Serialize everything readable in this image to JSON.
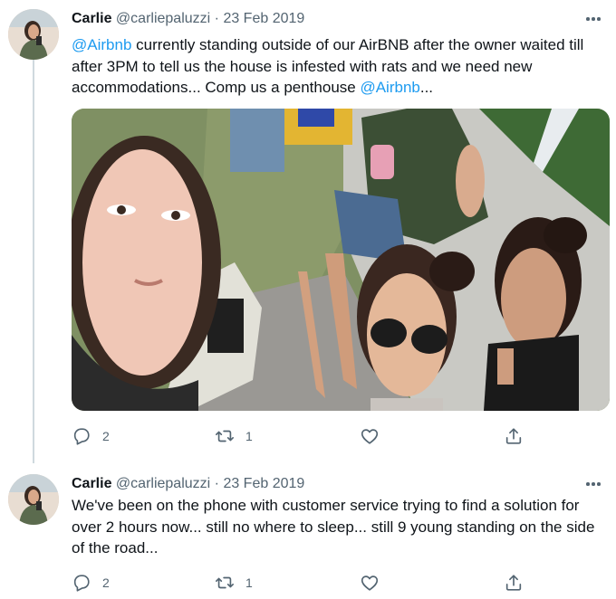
{
  "tweets": [
    {
      "author": {
        "name": "Carlie",
        "handle": "@carliepaluzzi"
      },
      "separator": "·",
      "date": "23 Feb 2019",
      "text": {
        "mention_start": "@Airbnb",
        "body": " currently standing outside of our AirBNB after the owner waited till after 3PM to tell us the house is infested with rats and we need new accommodations... Comp us a penthouse ",
        "mention_end": "@Airbnb",
        "ellipsis": "..."
      },
      "has_photo": true,
      "counts": {
        "replies": "2",
        "retweets": "1"
      }
    },
    {
      "author": {
        "name": "Carlie",
        "handle": "@carliepaluzzi"
      },
      "separator": "·",
      "date": "23 Feb 2019",
      "text": {
        "body": "We've been on the phone with customer service trying to find a solution for over 2 hours now... still no where to sleep... still 9 young standing on the side of the road..."
      },
      "has_photo": false,
      "counts": {
        "replies": "2",
        "retweets": "1"
      }
    }
  ],
  "colors": {
    "link": "#1d9bf0",
    "secondary": "#536471",
    "thread_line": "#cfd9de"
  },
  "icons": [
    "avatar-photo",
    "more-options-icon",
    "reply-icon",
    "retweet-icon",
    "like-icon",
    "share-icon"
  ]
}
